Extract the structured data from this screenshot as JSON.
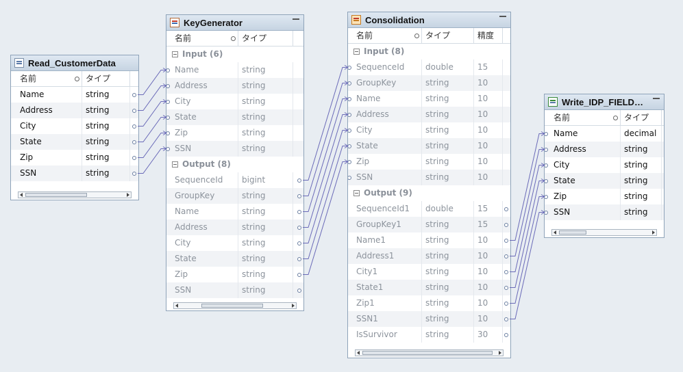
{
  "headers": {
    "name": "名前",
    "type": "タイプ",
    "precision": "精度"
  },
  "read": {
    "title": "Read_CustomerData",
    "rows": [
      {
        "name": "Name",
        "type": "string"
      },
      {
        "name": "Address",
        "type": "string"
      },
      {
        "name": "City",
        "type": "string"
      },
      {
        "name": "State",
        "type": "string"
      },
      {
        "name": "Zip",
        "type": "string"
      },
      {
        "name": "SSN",
        "type": "string"
      }
    ]
  },
  "keygen": {
    "title": "KeyGenerator",
    "input_label": "Input (6)",
    "output_label": "Output (8)",
    "inputs": [
      {
        "name": "Name",
        "type": "string"
      },
      {
        "name": "Address",
        "type": "string"
      },
      {
        "name": "City",
        "type": "string"
      },
      {
        "name": "State",
        "type": "string"
      },
      {
        "name": "Zip",
        "type": "string"
      },
      {
        "name": "SSN",
        "type": "string"
      }
    ],
    "outputs": [
      {
        "name": "SequenceId",
        "type": "bigint"
      },
      {
        "name": "GroupKey",
        "type": "string"
      },
      {
        "name": "Name",
        "type": "string"
      },
      {
        "name": "Address",
        "type": "string"
      },
      {
        "name": "City",
        "type": "string"
      },
      {
        "name": "State",
        "type": "string"
      },
      {
        "name": "Zip",
        "type": "string"
      },
      {
        "name": "SSN",
        "type": "string"
      }
    ]
  },
  "consolidation": {
    "title": "Consolidation",
    "input_label": "Input (8)",
    "output_label": "Output (9)",
    "inputs": [
      {
        "name": "SequenceId",
        "type": "double",
        "precision": "15"
      },
      {
        "name": "GroupKey",
        "type": "string",
        "precision": "10"
      },
      {
        "name": "Name",
        "type": "string",
        "precision": "10"
      },
      {
        "name": "Address",
        "type": "string",
        "precision": "10"
      },
      {
        "name": "City",
        "type": "string",
        "precision": "10"
      },
      {
        "name": "State",
        "type": "string",
        "precision": "10"
      },
      {
        "name": "Zip",
        "type": "string",
        "precision": "10"
      },
      {
        "name": "SSN",
        "type": "string",
        "precision": "10"
      }
    ],
    "outputs": [
      {
        "name": "SequenceId1",
        "type": "double",
        "precision": "15"
      },
      {
        "name": "GroupKey1",
        "type": "string",
        "precision": "15"
      },
      {
        "name": "Name1",
        "type": "string",
        "precision": "10"
      },
      {
        "name": "Address1",
        "type": "string",
        "precision": "10"
      },
      {
        "name": "City1",
        "type": "string",
        "precision": "10"
      },
      {
        "name": "State1",
        "type": "string",
        "precision": "10"
      },
      {
        "name": "Zip1",
        "type": "string",
        "precision": "10"
      },
      {
        "name": "SSN1",
        "type": "string",
        "precision": "10"
      },
      {
        "name": "IsSurvivor",
        "type": "string",
        "precision": "30"
      }
    ]
  },
  "write": {
    "title": "Write_IDP_FIELD…",
    "rows": [
      {
        "name": "Name",
        "type": "decimal"
      },
      {
        "name": "Address",
        "type": "string"
      },
      {
        "name": "City",
        "type": "string"
      },
      {
        "name": "State",
        "type": "string"
      },
      {
        "name": "Zip",
        "type": "string"
      },
      {
        "name": "SSN",
        "type": "string"
      }
    ]
  },
  "colors": {
    "link": "#6a6ab8",
    "canvas": "#e8edf2",
    "titlebar": "#c6d4e2"
  }
}
